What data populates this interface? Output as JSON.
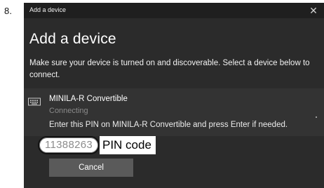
{
  "step_number": "8.",
  "dialog": {
    "window_title": "Add a device",
    "close_glyph": "✕",
    "heading": "Add a device",
    "instructions": "Make sure your device is turned on and discoverable. Select a device below to connect.",
    "device": {
      "icon": "keyboard-icon",
      "name": "MINILA-R Convertible",
      "status": "Connecting"
    },
    "pin_instruction": "Enter this PIN on MINILA-R Convertible and press Enter if needed.",
    "pin_value": "11388263",
    "pin_callout_label": "PIN code",
    "cancel_label": "Cancel"
  },
  "colors": {
    "dialog_bg": "#2b2b2b",
    "titlebar_bg": "#1f1f1f",
    "device_row_bg": "#333333",
    "button_bg": "#5a5a5a",
    "status_text": "#8a8a8a"
  }
}
